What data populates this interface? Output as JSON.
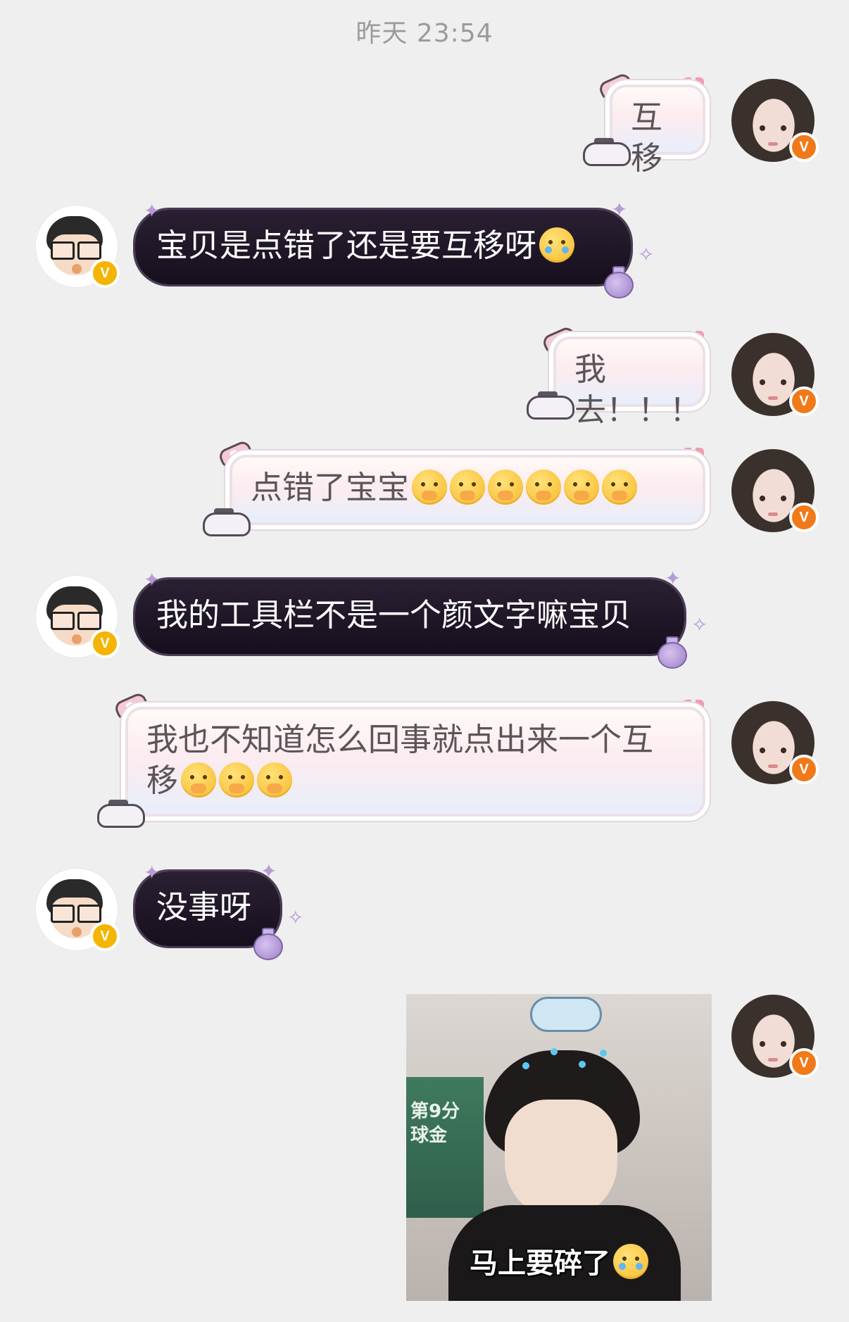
{
  "header": {
    "timestamp": "昨天 23:54"
  },
  "messages": [
    {
      "sender": "her",
      "type": "text",
      "text": "互移"
    },
    {
      "sender": "him",
      "type": "text",
      "text": "宝贝是点错了还是要互移呀",
      "emoji": [
        "loudly-crying-face"
      ]
    },
    {
      "sender": "her",
      "type": "text",
      "text": "我去！！！"
    },
    {
      "sender": "her",
      "type": "text",
      "text": "点错了宝宝",
      "emoji": [
        "face-holding-back-tears",
        "face-holding-back-tears",
        "face-holding-back-tears",
        "face-holding-back-tears",
        "face-holding-back-tears",
        "face-holding-back-tears"
      ]
    },
    {
      "sender": "him",
      "type": "text",
      "text": "我的工具栏不是一个颜文字嘛宝贝"
    },
    {
      "sender": "her",
      "type": "text",
      "line1": "我也不知道怎么回事就点出来一个互",
      "line2": "移",
      "emoji": [
        "face-holding-back-tears",
        "face-holding-back-tears",
        "face-holding-back-tears"
      ]
    },
    {
      "sender": "him",
      "type": "text",
      "text": "没事呀"
    },
    {
      "sender": "her",
      "type": "image",
      "caption": "马上要碎了",
      "caption_emoji": "pleading-face",
      "background_sign_text": [
        "第9分",
        "球金"
      ]
    }
  ],
  "badges": {
    "verified_mark": "V"
  },
  "colors": {
    "background": "#efefef",
    "her_badge": "#f07a1a",
    "him_badge": "#f4b400",
    "dark_bubble": "#1c1422",
    "pink_bubble": "#fcecef"
  }
}
